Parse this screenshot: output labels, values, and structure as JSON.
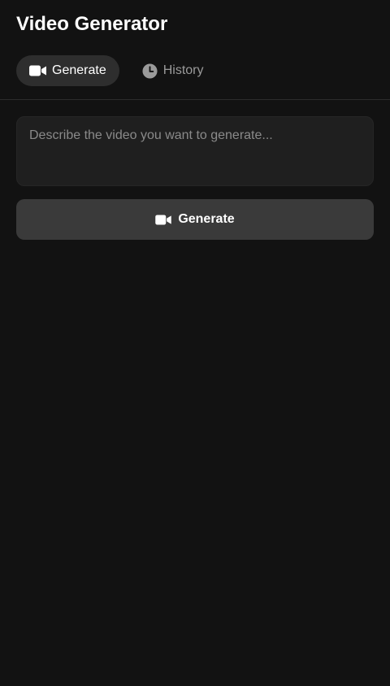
{
  "app": {
    "title": "Video Generator"
  },
  "tabs": [
    {
      "label": "Generate",
      "icon": "video-camera-icon",
      "active": true
    },
    {
      "label": "History",
      "icon": "clock-icon",
      "active": false
    }
  ],
  "prompt": {
    "placeholder": "Describe the video you want to generate...",
    "value": ""
  },
  "generate_button": {
    "label": "Generate",
    "icon": "video-camera-icon"
  },
  "colors": {
    "background": "#121212",
    "active_tab_bg": "#2e2e2e",
    "input_bg": "#1f1f1f",
    "button_bg": "#3a3a3a",
    "inactive_text": "#9a9a9a"
  }
}
